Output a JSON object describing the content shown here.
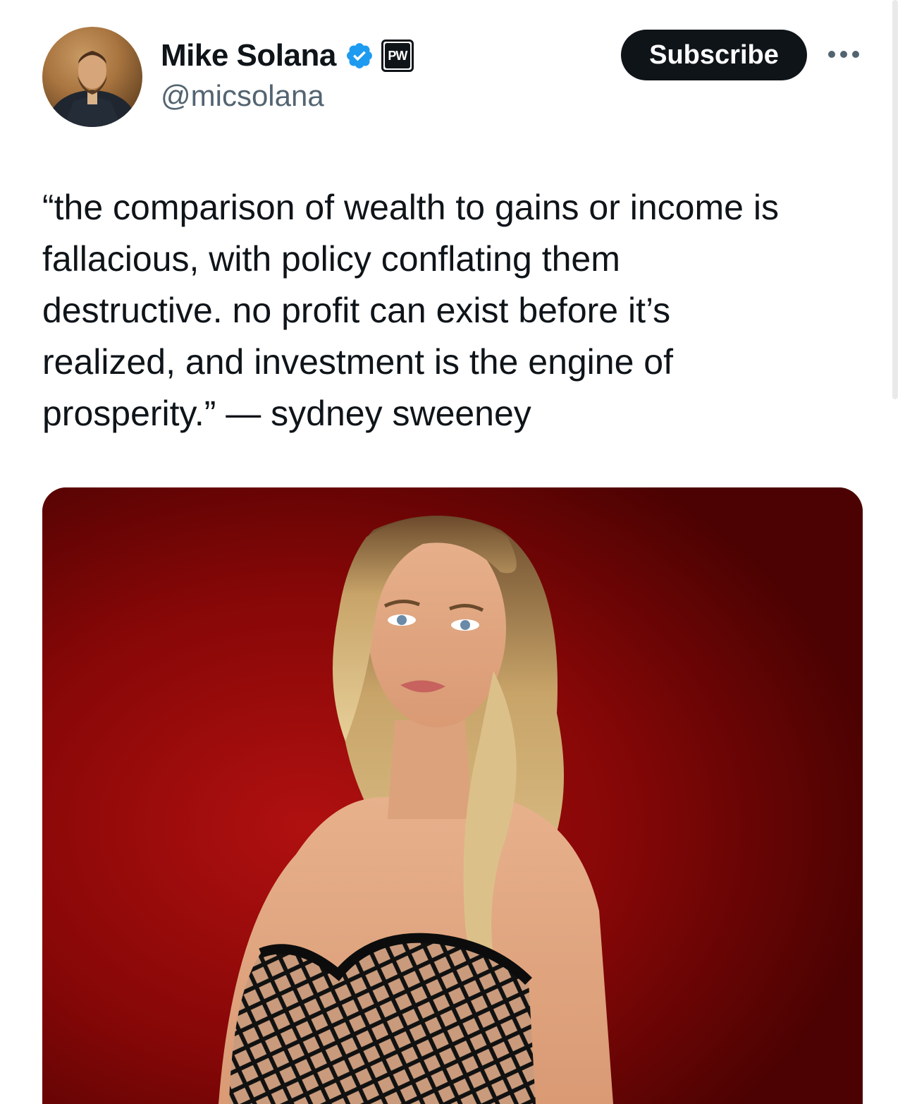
{
  "author": {
    "display_name": "Mike Solana",
    "handle": "@micsolana",
    "verified": true,
    "affiliate_badge": "PW"
  },
  "actions": {
    "subscribe_label": "Subscribe"
  },
  "icons": {
    "verified": "verified-badge-icon",
    "more": "more-options-icon",
    "affiliate": "affiliate-badge-icon"
  },
  "tweet": {
    "text": "“the comparison of wealth to gains or income is\nfallacious, with policy conflating them\ndestructive. no profit can exist before it’s\nrealized, and investment is the engine of\nprosperity.” — sydney sweeney"
  },
  "colors": {
    "text_primary": "#0f1419",
    "text_secondary": "#536471",
    "verified_blue": "#1d9bf0",
    "subscribe_bg": "#0f1419",
    "media_background": "#8a0606"
  }
}
